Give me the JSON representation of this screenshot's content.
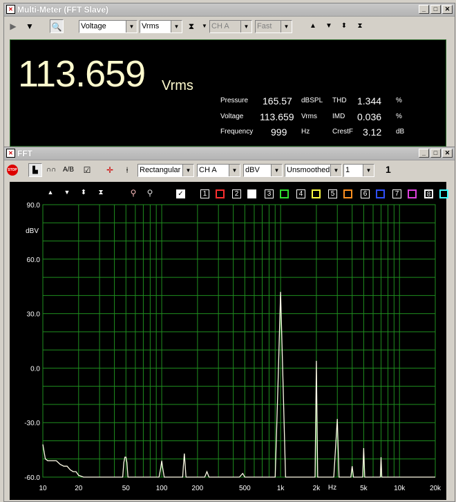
{
  "meter_window": {
    "title": "Multi-Meter (FFT Slave)",
    "combos": {
      "measure": "Voltage",
      "unit": "Vrms",
      "channel": "CH A",
      "speed": "Fast"
    },
    "reading": {
      "value": "113.659",
      "unit": "Vrms"
    },
    "stats": [
      {
        "label": "Pressure",
        "value": "165.57",
        "unit": "dBSPL"
      },
      {
        "label": "Voltage",
        "value": "113.659",
        "unit": "Vrms"
      },
      {
        "label": "Frequency",
        "value": "999",
        "unit": "Hz"
      },
      {
        "label": "THD",
        "value": "1.344",
        "unit": "%"
      },
      {
        "label": "IMD",
        "value": "0.036",
        "unit": "%"
      },
      {
        "label": "CrestF",
        "value": "3.12",
        "unit": "dB"
      }
    ]
  },
  "fft_window": {
    "title": "FFT",
    "stop_label": "STOP",
    "combos": {
      "window": "Rectangular",
      "channel": "CH A",
      "unit": "dBV",
      "smoothing": "Unsmoothed",
      "avg": "1"
    },
    "avg_count": "1",
    "trace_numbers": [
      "1",
      "2",
      "3",
      "4",
      "5",
      "6",
      "7",
      "8"
    ],
    "trace_colors": [
      "#ff3030",
      "#ffffff",
      "#30e030",
      "#ffff40",
      "#ff9020",
      "#3050ff",
      "#e040e0",
      "#40ffff"
    ],
    "grid_color": "#1f8f1f"
  },
  "chart_data": {
    "type": "line",
    "ylabel": "dBV",
    "xlabel": "Hz",
    "yticks": [
      "90.0",
      "60.0",
      "30.0",
      "0.0",
      "-30.0",
      "-60.0"
    ],
    "ytick_values": [
      90,
      60,
      30,
      0,
      -30,
      -60
    ],
    "ylim": [
      -60,
      90
    ],
    "xscale": "log",
    "xlim": [
      10,
      20000
    ],
    "xticks": [
      "10",
      "20",
      "50",
      "100",
      "200",
      "500",
      "1k",
      "2k",
      "5k",
      "10k",
      "20k"
    ],
    "xtick_values": [
      10,
      20,
      50,
      100,
      200,
      500,
      1000,
      2000,
      5000,
      10000,
      20000
    ],
    "grid": true,
    "series": [
      {
        "x": [
          10,
          10.5,
          11,
          12,
          13,
          14,
          15,
          16,
          17,
          18,
          19,
          20,
          22,
          25,
          30,
          40,
          47,
          48,
          49,
          50,
          51,
          52,
          55,
          60,
          80,
          95,
          98,
          100,
          102,
          105,
          110,
          130,
          150,
          152,
          155,
          160,
          180,
          200,
          230,
          240,
          250,
          300,
          450,
          480,
          500,
          600,
          900,
          950,
          1000,
          1050,
          1100,
          1500,
          1950,
          2000,
          2050,
          2200,
          2800,
          3000,
          3100,
          3500,
          3900,
          4000,
          4100,
          4600,
          4900,
          5000,
          5100,
          5500,
          6900,
          7000,
          7100,
          8000,
          12000,
          20000
        ],
        "y": [
          -42,
          -50,
          -51,
          -51,
          -51,
          -53,
          -54,
          -54,
          -56,
          -57,
          -57,
          -59,
          -60,
          -60,
          -60,
          -60,
          -60,
          -52,
          -49,
          -49,
          -52,
          -60,
          -60,
          -60,
          -60,
          -60,
          -55,
          -51,
          -55,
          -60,
          -60,
          -60,
          -60,
          -54,
          -47,
          -60,
          -60,
          -60,
          -60,
          -57,
          -60,
          -60,
          -60,
          -58,
          -60,
          -60,
          -60,
          -10,
          42,
          -10,
          -60,
          -60,
          -60,
          4,
          -60,
          -60,
          -60,
          -28,
          -60,
          -60,
          -60,
          -54,
          -60,
          -60,
          -60,
          -44,
          -60,
          -60,
          -60,
          -49,
          -60,
          -60,
          -60,
          -60
        ]
      }
    ]
  }
}
